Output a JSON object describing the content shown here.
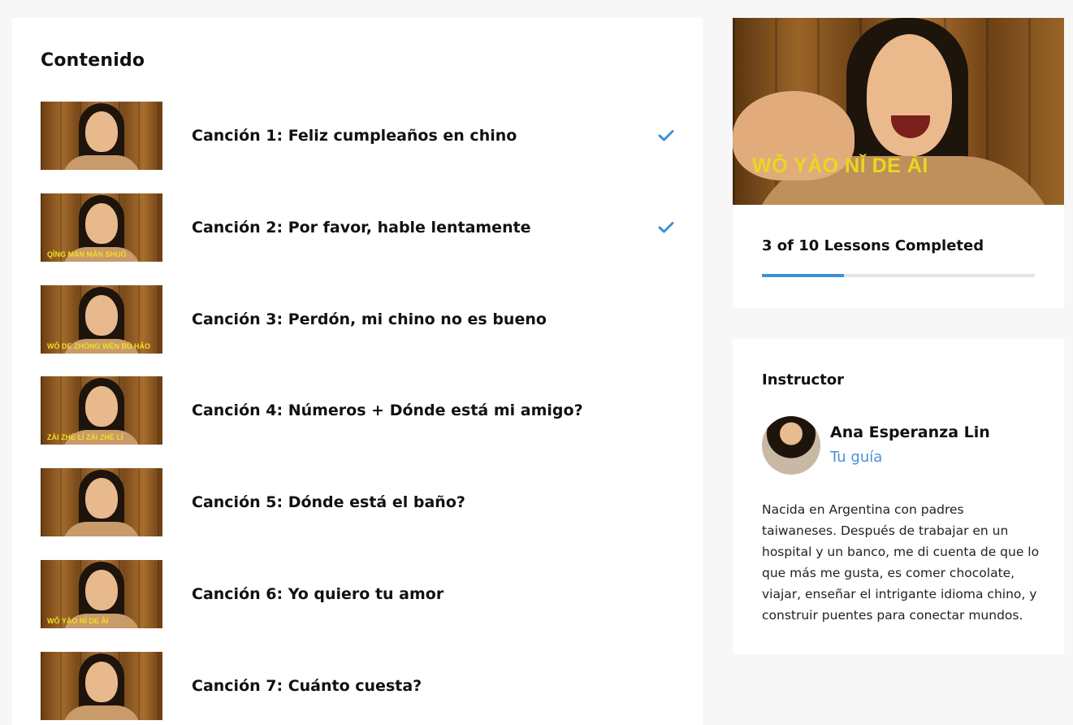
{
  "content": {
    "title": "Contenido",
    "lessons": [
      {
        "title": "Canción 1: Feliz cumpleaños en chino",
        "caption": "",
        "completed": true
      },
      {
        "title": "Canción 2: Por favor, hable lentamente",
        "caption": "QǏNG MÀN MÀN SHUŌ",
        "completed": true
      },
      {
        "title": "Canción 3: Perdón, mi chino no es bueno",
        "caption": "WǑ DE ZHŌNG WÉN BÙ HǍO",
        "completed": false
      },
      {
        "title": "Canción 4: Números + Dónde está mi amigo?",
        "caption": "ZÀI ZHÈ LǏ ZÀI ZHÈ LǏ",
        "completed": false
      },
      {
        "title": "Canción 5: Dónde está el baño?",
        "caption": "",
        "completed": false
      },
      {
        "title": "Canción 6: Yo quiero tu amor",
        "caption": "WǑ YÀO NǏ DE ÀI",
        "completed": false
      },
      {
        "title": "Canción 7: Cuánto cuesta?",
        "caption": "",
        "completed": false
      }
    ]
  },
  "course_card": {
    "hero_caption": "WǑ YÀO NǏ DE ÀI",
    "progress_text": "3 of 10 Lessons Completed",
    "progress_fraction": 0.3,
    "accent_color": "#3f8fd8"
  },
  "instructor": {
    "heading": "Instructor",
    "name": "Ana Esperanza Lin",
    "role": "Tu guía",
    "bio": "Nacida en Argentina con padres taiwaneses. Después de trabajar en un hospital y un banco, me di cuenta de que lo que más me gusta, es comer chocolate, viajar, enseñar el intrigante idioma chino, y construir puentes para conectar mundos."
  },
  "icons": {
    "completed": "checkmark-icon"
  }
}
